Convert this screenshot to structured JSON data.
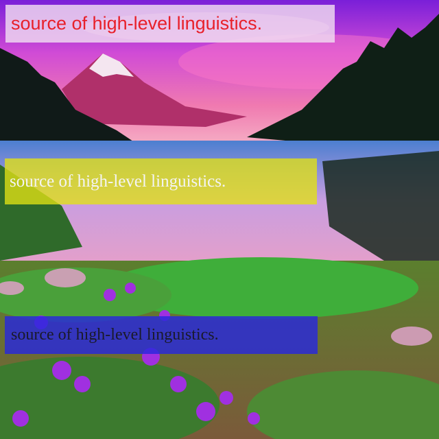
{
  "photo": {
    "subject": "landscape-photo"
  },
  "captions": {
    "top": {
      "text": "source of high-level linguistics.",
      "color": "#e8202a"
    },
    "middle": {
      "text": "source of high-level linguistics.",
      "color": "#f4f4f4"
    },
    "bottom": {
      "text": "source of high-level linguistics.",
      "color": "#1a1a2a"
    }
  }
}
